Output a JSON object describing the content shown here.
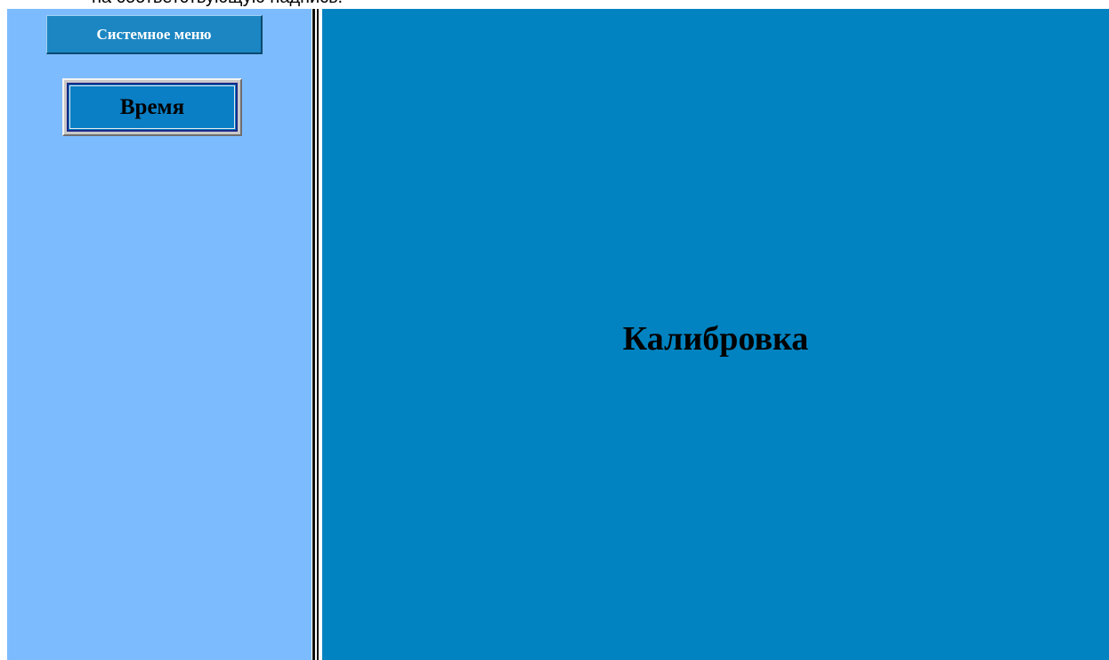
{
  "top_strip": {
    "text": "на соответствующую надпись."
  },
  "sidebar": {
    "system_menu_label": "Системное меню",
    "time_button_label": "Время"
  },
  "main": {
    "title": "Калибровка"
  },
  "colors": {
    "sidebar_bg": "#7dbbff",
    "main_bg": "#0083c0",
    "button_bg": "#1b86c2",
    "time_button_bg": "#0a7fc5"
  }
}
